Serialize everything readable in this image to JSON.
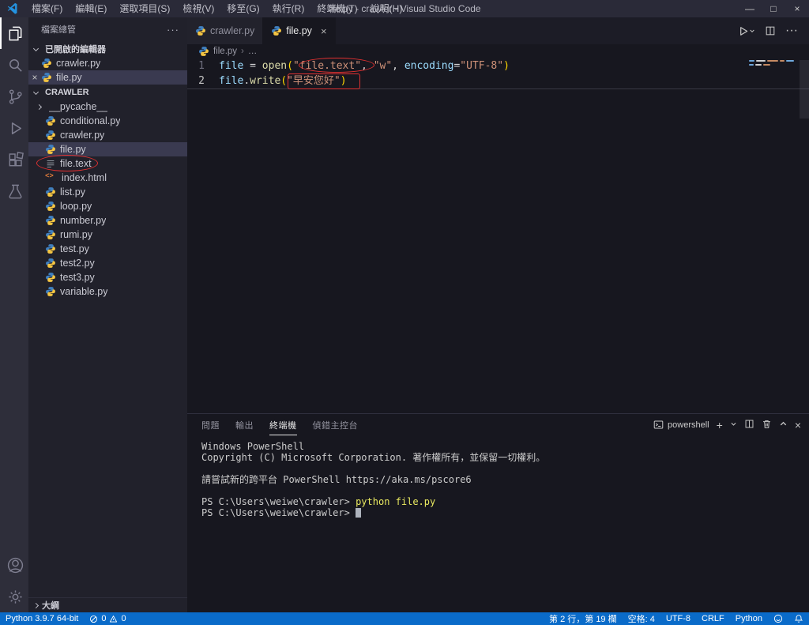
{
  "colors": {
    "statusbar": "#0a6bc9",
    "annotation_red": "#e03131",
    "string": "#ce9178",
    "function": "#dcdcaa",
    "variable": "#9cdcfe"
  },
  "titlebar": {
    "app_title": "file.py - crawler - Visual Studio Code",
    "menus": [
      "檔案(F)",
      "編輯(E)",
      "選取項目(S)",
      "檢視(V)",
      "移至(G)",
      "執行(R)",
      "終端機(T)",
      "說明(H)"
    ],
    "window_controls": [
      "minimize-icon",
      "maximize-icon",
      "close-icon"
    ]
  },
  "activity_bar": {
    "top_icons": [
      "explorer-icon",
      "search-icon",
      "source-control-icon",
      "run-debug-icon",
      "extensions-icon",
      "testing-icon"
    ],
    "bottom_icons": [
      "account-icon",
      "settings-gear-icon"
    ],
    "active": "explorer-icon"
  },
  "sidebar": {
    "title": "檔案總管",
    "open_editors": {
      "label": "已開啟的編輯器",
      "items": [
        {
          "name": "crawler.py",
          "icon": "python",
          "active": false
        },
        {
          "name": "file.py",
          "icon": "python",
          "active": true
        }
      ]
    },
    "project": {
      "label": "CRAWLER",
      "items": [
        {
          "name": "__pycache__",
          "icon": "folder",
          "kind": "folder"
        },
        {
          "name": "conditional.py",
          "icon": "python"
        },
        {
          "name": "crawler.py",
          "icon": "python"
        },
        {
          "name": "file.py",
          "icon": "python",
          "selected": true
        },
        {
          "name": "file.text",
          "icon": "text",
          "annotated": true
        },
        {
          "name": "index.html",
          "icon": "html"
        },
        {
          "name": "list.py",
          "icon": "python"
        },
        {
          "name": "loop.py",
          "icon": "python"
        },
        {
          "name": "number.py",
          "icon": "python"
        },
        {
          "name": "rumi.py",
          "icon": "python"
        },
        {
          "name": "test.py",
          "icon": "python"
        },
        {
          "name": "test2.py",
          "icon": "python"
        },
        {
          "name": "test3.py",
          "icon": "python"
        },
        {
          "name": "variable.py",
          "icon": "python"
        }
      ]
    },
    "outline_label": "大綱"
  },
  "editor": {
    "tabs": [
      {
        "label": "crawler.py",
        "icon": "python",
        "active": false
      },
      {
        "label": "file.py",
        "icon": "python",
        "active": true
      }
    ],
    "action_icons": [
      "run-icon",
      "run-dropdown-icon",
      "split-editor-icon",
      "more-actions-icon"
    ],
    "breadcrumb": {
      "file": "file.py",
      "more": "…"
    },
    "code": {
      "lines": [
        {
          "num": "1",
          "current": false,
          "tokens": [
            {
              "t": "file",
              "c": "var"
            },
            {
              "t": " = ",
              "c": "plain"
            },
            {
              "t": "open",
              "c": "fn"
            },
            {
              "t": "(",
              "c": "br"
            },
            {
              "t": "\"file.text\"",
              "c": "str"
            },
            {
              "t": ", ",
              "c": "plain"
            },
            {
              "t": "\"w\"",
              "c": "str"
            },
            {
              "t": ", ",
              "c": "plain"
            },
            {
              "t": "encoding",
              "c": "var"
            },
            {
              "t": "=",
              "c": "plain"
            },
            {
              "t": "\"UTF-8\"",
              "c": "str"
            },
            {
              "t": ")",
              "c": "br"
            }
          ]
        },
        {
          "num": "2",
          "current": true,
          "tokens": [
            {
              "t": "file",
              "c": "var"
            },
            {
              "t": ".",
              "c": "plain"
            },
            {
              "t": "write",
              "c": "fn"
            },
            {
              "t": "(",
              "c": "br"
            },
            {
              "t": "\"早安您好\"",
              "c": "str"
            },
            {
              "t": ")",
              "c": "br"
            }
          ]
        }
      ]
    }
  },
  "panel": {
    "tabs": [
      {
        "label": "問題",
        "active": false
      },
      {
        "label": "輸出",
        "active": false
      },
      {
        "label": "終端機",
        "active": true
      },
      {
        "label": "偵錯主控台",
        "active": false
      }
    ],
    "shell_label": "powershell",
    "action_icons": [
      "shell-icon",
      "new-terminal-icon",
      "dropdown-icon",
      "split-terminal-icon",
      "trash-icon",
      "maximize-panel-icon",
      "close-panel-icon"
    ],
    "terminal_lines": [
      {
        "segs": [
          {
            "t": "Windows PowerShell",
            "c": "plain"
          }
        ]
      },
      {
        "segs": [
          {
            "t": "Copyright (C) Microsoft Corporation. 著作權所有，並保留一切權利。",
            "c": "plain"
          }
        ]
      },
      {
        "segs": []
      },
      {
        "segs": [
          {
            "t": "請嘗試新的跨平台 PowerShell https://aka.ms/pscore6",
            "c": "plain"
          }
        ]
      },
      {
        "segs": []
      },
      {
        "segs": [
          {
            "t": "PS C:\\Users\\weiwe\\crawler> ",
            "c": "plain"
          },
          {
            "t": "python file.py",
            "c": "cmd"
          }
        ]
      },
      {
        "segs": [
          {
            "t": "PS C:\\Users\\weiwe\\crawler> ",
            "c": "plain"
          },
          {
            "t": "",
            "c": "cursor"
          }
        ]
      }
    ]
  },
  "statusbar": {
    "interpreter": "Python 3.9.7 64-bit",
    "errors": "0",
    "warnings": "0",
    "cursor_position": "第 2 行，第 19 欄",
    "indentation": "空格: 4",
    "encoding": "UTF-8",
    "eol": "CRLF",
    "language": "Python",
    "right_icons": [
      "feedback-icon",
      "bell-icon"
    ]
  },
  "annotations": [
    {
      "shape": "ellipse",
      "marks": "file.text item in explorer"
    },
    {
      "shape": "ellipse",
      "marks": "\"file.text\" string in code line 1"
    },
    {
      "shape": "rect",
      "marks": "(\"早安您好\") in code line 2"
    }
  ]
}
